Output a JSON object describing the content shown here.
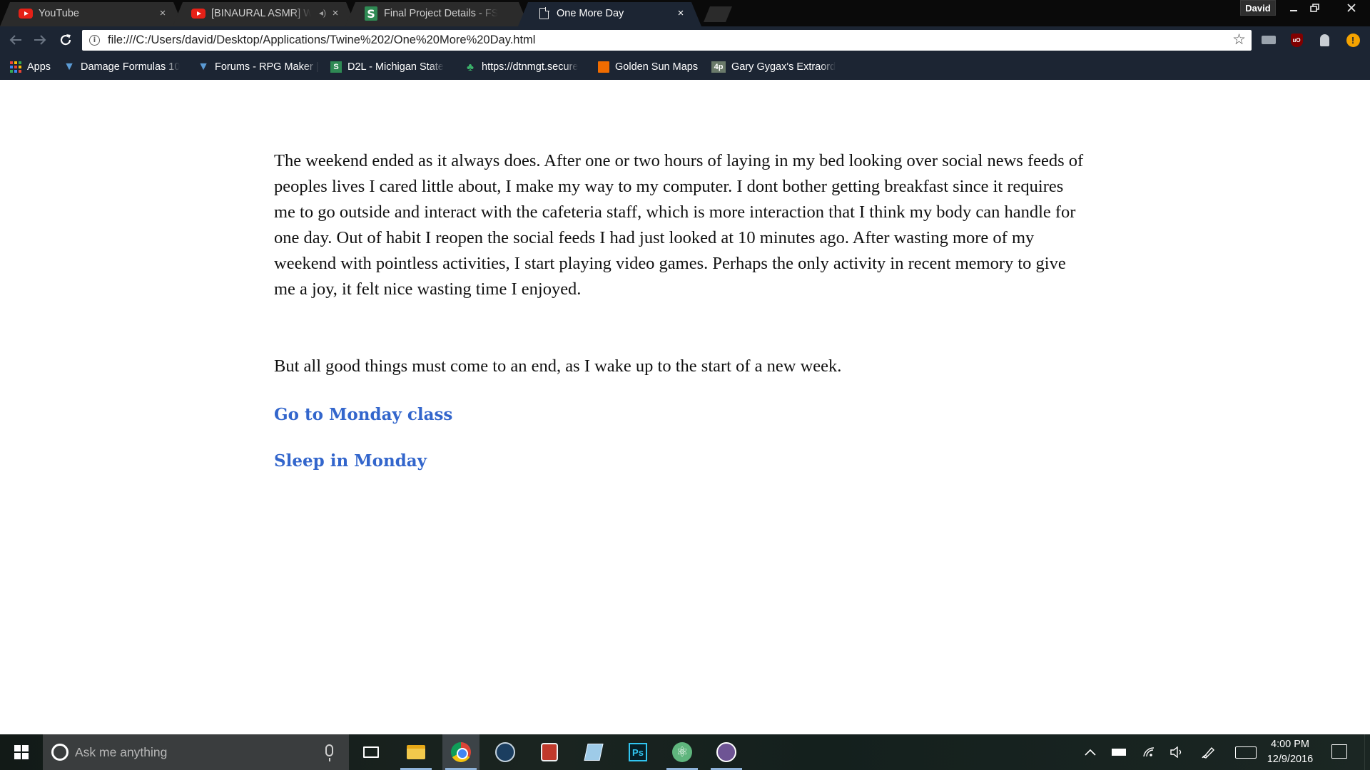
{
  "browser": {
    "profile_name": "David",
    "tabs": [
      {
        "title": "YouTube",
        "icon": "youtube-icon",
        "close": "×"
      },
      {
        "title": "[BINAURAL ASMR] Wi",
        "icon": "youtube-icon",
        "audio": "◂)",
        "close": "×"
      },
      {
        "title": "Final Project Details - FS",
        "icon": "s-icon",
        "icon_text": "S",
        "close": "×"
      },
      {
        "title": "One More Day",
        "icon": "document-icon",
        "close": "×"
      }
    ],
    "url": "file:///C:/Users/david/Desktop/Applications/Twine%202/One%20More%20Day.html",
    "bookmarks": [
      {
        "label": "Apps",
        "icon": "apps-grid-icon"
      },
      {
        "label": "Damage Formulas 10",
        "icon": "rpgmaker-icon"
      },
      {
        "label": "Forums - RPG Maker |",
        "icon": "rpgmaker-icon"
      },
      {
        "label": "D2L - Michigan State",
        "icon": "d2l-icon",
        "icon_text": "S"
      },
      {
        "label": "https://dtnmgt.secure",
        "icon": "tree-icon"
      },
      {
        "label": "Golden Sun Maps",
        "icon": "orange-box-icon"
      },
      {
        "label": "Gary Gygax's Extraord",
        "icon": "4p-icon",
        "icon_text": "4p"
      }
    ],
    "accent_color": "#1c2533",
    "tab_strip_color": "#0a0a0a"
  },
  "story": {
    "paragraph_1": "The weekend ended as it always does. After one or two hours of laying in my bed looking over social news feeds of peoples lives I cared little about, I make my way to my computer. I dont bother getting breakfast since it requires me to go outside and interact with the cafeteria staff, which is more interaction that I think my body can handle for one day. Out of habit I reopen the social feeds I had just looked at 10 minutes ago. After wasting more of my weekend with pointless activities, I start playing video games. Perhaps the only activity in recent memory to give me a joy, it felt nice wasting time I enjoyed.",
    "paragraph_2": "But all good things must come to an end, as I wake up to the start of a new week.",
    "choices": [
      {
        "label": "Go to Monday class"
      },
      {
        "label": "Sleep in Monday"
      }
    ],
    "link_color": "#3366cc"
  },
  "taskbar": {
    "search_placeholder": "Ask me anything",
    "ps_label": "Ps",
    "time": "4:00 PM",
    "date": "12/9/2016",
    "apps": [
      "task-view-icon",
      "file-explorer-icon",
      "chrome-icon",
      "steam-icon",
      "game-icon",
      "notepad-icon",
      "photoshop-icon",
      "atom-icon",
      "github-icon"
    ]
  }
}
